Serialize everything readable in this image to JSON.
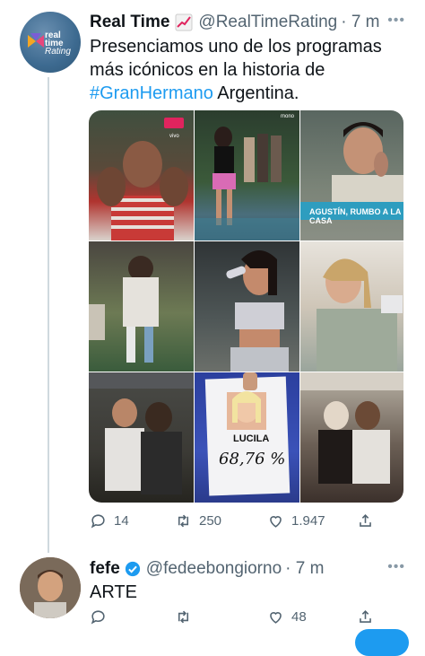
{
  "tweet1": {
    "name": "Real Time",
    "handle": "@RealTimeRating",
    "time": "· 7 m",
    "avatar_text": [
      "real",
      "time",
      "Rating"
    ],
    "text_before": "Presenciamos uno de los programas más icónicos en la historia de ",
    "hashtag": "#GranHermano",
    "text_after": " Argentina.",
    "images": [
      {
        "icon": "man-covering-face-photo",
        "caption": ""
      },
      {
        "icon": "woman-walking-photo",
        "caption": ""
      },
      {
        "icon": "young-man-crying-photo",
        "caption": "AGUSTÍN, RUMBO A LA CASA"
      },
      {
        "icon": "couple-hugging-photo",
        "caption": ""
      },
      {
        "icon": "woman-drinking-photo",
        "caption": ""
      },
      {
        "icon": "woman-blanket-photo",
        "caption": ""
      },
      {
        "icon": "men-hugging-photo",
        "caption": ""
      },
      {
        "icon": "vote-card-photo",
        "caption": "LUCILA",
        "value": "68,76 %"
      },
      {
        "icon": "group-hug-photo",
        "caption": ""
      }
    ],
    "stats": {
      "replies": "14",
      "retweets": "250",
      "likes": "1.947"
    }
  },
  "tweet2": {
    "name": "fefe",
    "handle": "@fedeebongiorno",
    "time": "· 7 m",
    "text": "ARTE",
    "stats": {
      "replies": "",
      "retweets": "",
      "likes": "48"
    }
  },
  "colors": {
    "accent": "#1d9bf0",
    "muted": "#536471",
    "line": "#cfd9de"
  }
}
